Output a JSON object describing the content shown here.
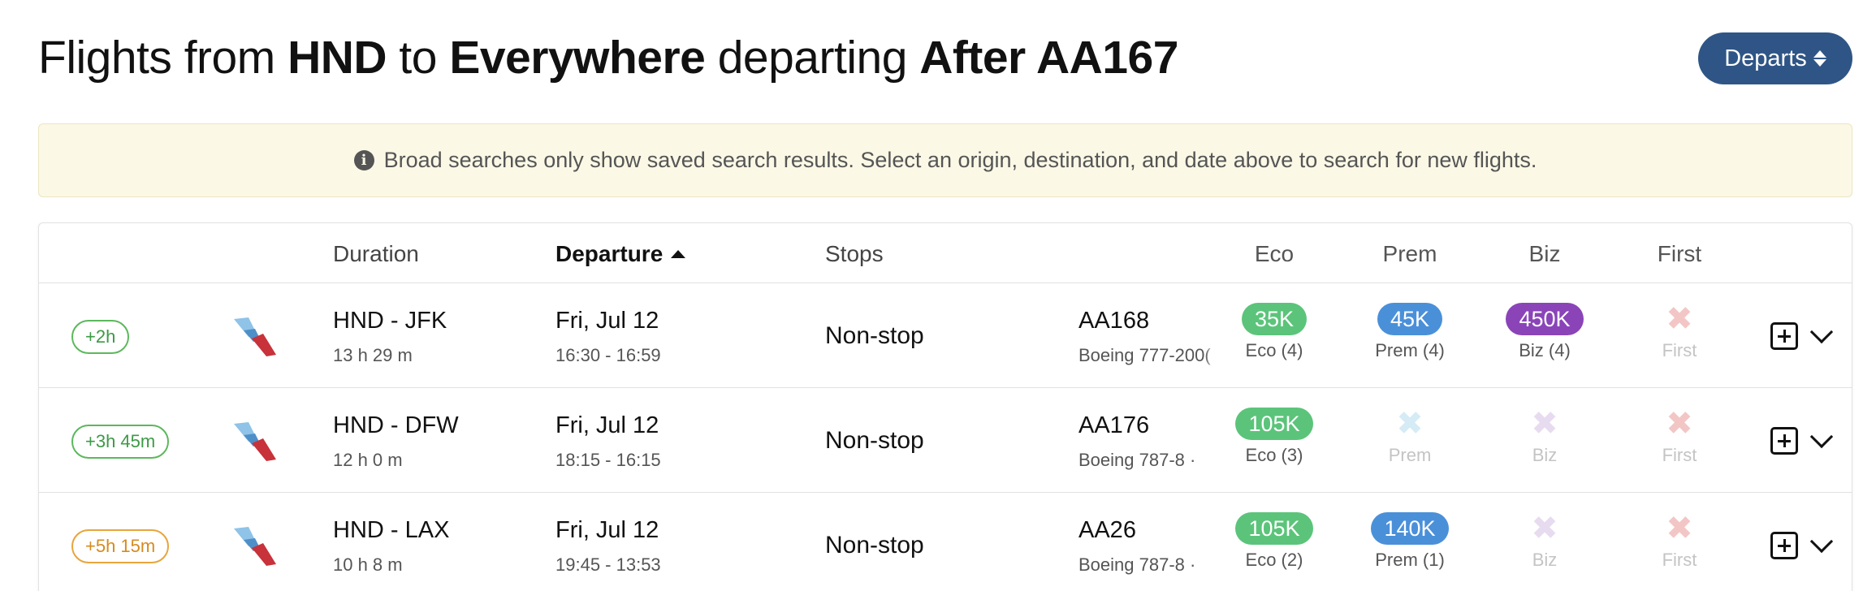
{
  "header": {
    "title_prefix": "Flights from",
    "origin": "HND",
    "title_to": "to",
    "destination": "Everywhere",
    "title_departing": "departing",
    "after": "After AA167",
    "sort_button_label": "Departs"
  },
  "banner": {
    "icon": "info-circle-icon",
    "text": "Broad searches only show saved search results. Select an origin, destination, and date above to search for new flights."
  },
  "table": {
    "columns": {
      "duration": "Duration",
      "departure": "Departure",
      "stops": "Stops",
      "eco": "Eco",
      "prem": "Prem",
      "biz": "Biz",
      "first": "First"
    },
    "sorted_by": "departure",
    "sort_direction": "ascending"
  },
  "colors": {
    "eco": "#5bc47a",
    "prem": "#4a90d9",
    "biz": "#8a44b8",
    "first": "#f3c6c6",
    "prem_unavailable": "#d5ebf5",
    "biz_unavailable": "#e7dcef",
    "badge_green": "#5cb85c",
    "badge_orange": "#e7a53c",
    "button": "#2f5586",
    "banner_bg": "#fbf8e6"
  },
  "flights": [
    {
      "delta": "+2h",
      "delta_color": "green",
      "route": "HND - JFK",
      "duration": "13 h 29 m",
      "date": "Fri, Jul 12",
      "times": "16:30 - 16:59",
      "stops": "Non-stop",
      "flight_no": "AA168",
      "aircraft": "Boeing 777-200(",
      "eco": {
        "available": true,
        "points": "35K",
        "label": "Eco (4)"
      },
      "prem": {
        "available": true,
        "points": "45K",
        "label": "Prem (4)"
      },
      "biz": {
        "available": true,
        "points": "450K",
        "label": "Biz (4)"
      },
      "first": {
        "available": false,
        "label": "First"
      }
    },
    {
      "delta": "+3h 45m",
      "delta_color": "green",
      "route": "HND - DFW",
      "duration": "12 h 0 m",
      "date": "Fri, Jul 12",
      "times": "18:15 - 16:15",
      "stops": "Non-stop",
      "flight_no": "AA176",
      "aircraft": "Boeing 787-8 · ",
      "eco": {
        "available": true,
        "points": "105K",
        "label": "Eco (3)"
      },
      "prem": {
        "available": false,
        "label": "Prem"
      },
      "biz": {
        "available": false,
        "label": "Biz"
      },
      "first": {
        "available": false,
        "label": "First"
      }
    },
    {
      "delta": "+5h 15m",
      "delta_color": "orange",
      "route": "HND - LAX",
      "duration": "10 h 8 m",
      "date": "Fri, Jul 12",
      "times": "19:45 - 13:53",
      "stops": "Non-stop",
      "flight_no": "AA26",
      "aircraft": "Boeing 787-8 · ",
      "eco": {
        "available": true,
        "points": "105K",
        "label": "Eco (2)"
      },
      "prem": {
        "available": true,
        "points": "140K",
        "label": "Prem (1)"
      },
      "biz": {
        "available": false,
        "label": "Biz"
      },
      "first": {
        "available": false,
        "label": "First"
      }
    }
  ]
}
